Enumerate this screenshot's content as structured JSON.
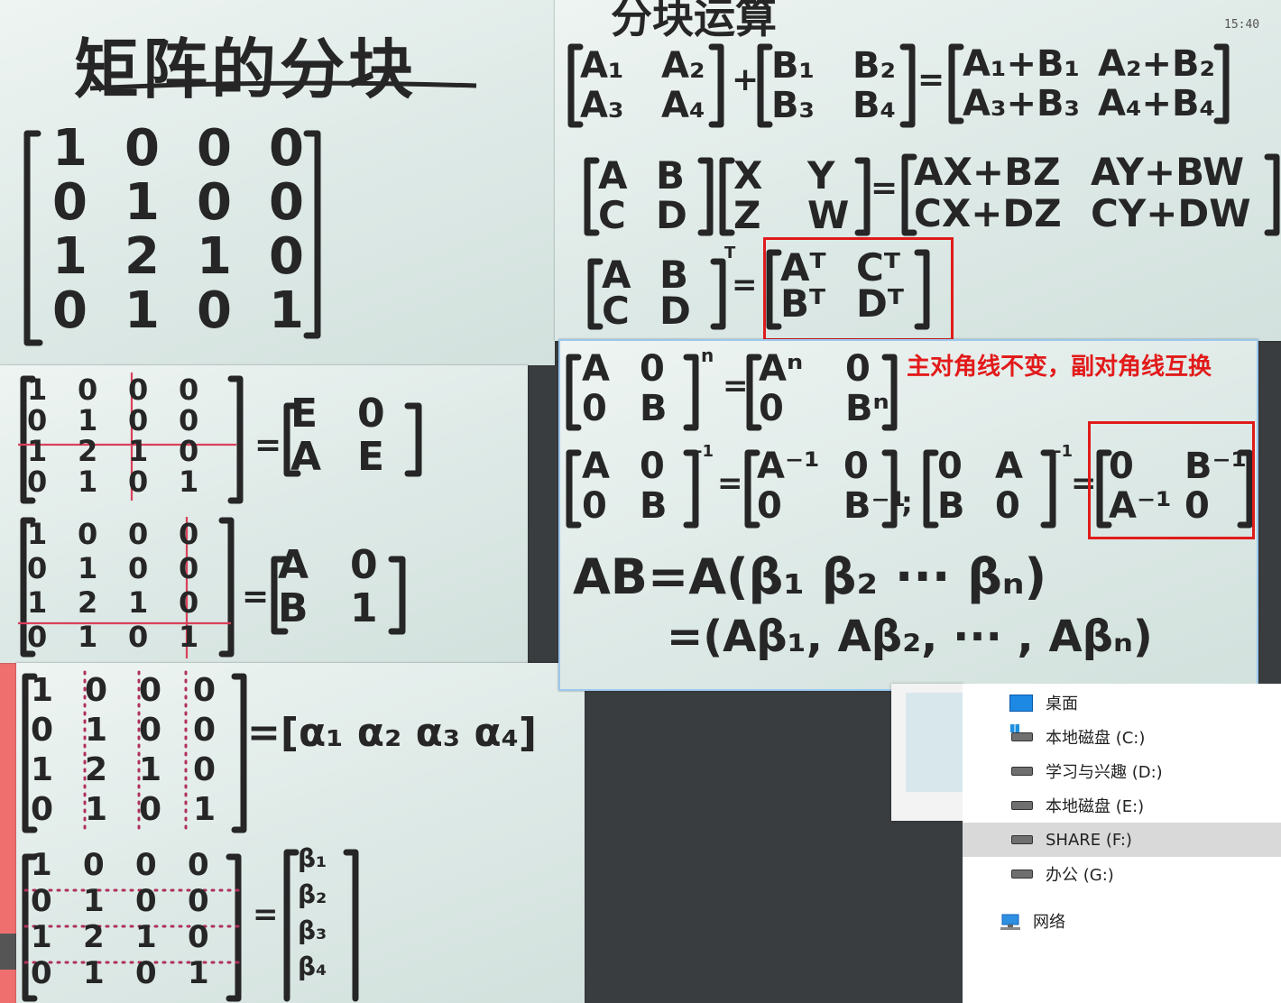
{
  "title": "矩阵的分块",
  "ops_title": "分块运算",
  "clock": "15:40",
  "annotation": "主对角线不变，副对角线互换",
  "matrix": [
    [
      "1",
      "0",
      "0",
      "0"
    ],
    [
      "0",
      "1",
      "0",
      "0"
    ],
    [
      "1",
      "2",
      "1",
      "0"
    ],
    [
      "0",
      "1",
      "0",
      "1"
    ]
  ],
  "results": {
    "block_EA": [
      [
        "E",
        "0"
      ],
      [
        "A",
        "E"
      ]
    ],
    "block_AB1": [
      [
        "A",
        "0"
      ],
      [
        "B",
        "1"
      ]
    ],
    "alpha_row": "=[α₁ α₂ α₃ α₄]",
    "beta_col": [
      "β₁",
      "β₂",
      "β₃",
      "β₄"
    ]
  },
  "formulas": {
    "add_lhs1": [
      [
        "A₁",
        "A₂"
      ],
      [
        "A₃",
        "A₄"
      ]
    ],
    "add_lhs2": [
      [
        "B₁",
        "B₂"
      ],
      [
        "B₃",
        "B₄"
      ]
    ],
    "add_rhs": [
      [
        "A₁+B₁",
        "A₂+B₂"
      ],
      [
        "A₃+B₃",
        "A₄+B₄"
      ]
    ],
    "mul_lhs1": [
      [
        "A",
        "B"
      ],
      [
        "C",
        "D"
      ]
    ],
    "mul_lhs2": [
      [
        "X",
        "Y"
      ],
      [
        "Z",
        "W"
      ]
    ],
    "mul_rhs": [
      [
        "AX+BZ",
        "AY+BW"
      ],
      [
        "CX+DZ",
        "CY+DW"
      ]
    ],
    "tr_lhs": [
      [
        "A",
        "B"
      ],
      [
        "C",
        "D"
      ]
    ],
    "tr_rhs": [
      [
        "Aᵀ",
        "Cᵀ"
      ],
      [
        "Bᵀ",
        "Dᵀ"
      ]
    ],
    "pow_lhs": [
      [
        "A",
        "0"
      ],
      [
        "0",
        "B"
      ]
    ],
    "pow_rhs": [
      [
        "Aⁿ",
        "0"
      ],
      [
        "0",
        "Bⁿ"
      ]
    ],
    "inv_lhs": [
      [
        "A",
        "0"
      ],
      [
        "0",
        "B"
      ]
    ],
    "inv_rhs": [
      [
        "A⁻¹",
        "0"
      ],
      [
        "0",
        "B⁻¹"
      ]
    ],
    "inv2_lhs": [
      [
        "0",
        "A"
      ],
      [
        "B",
        "0"
      ]
    ],
    "inv2_rhs": [
      [
        "0",
        "B⁻¹"
      ],
      [
        "A⁻¹",
        "0"
      ]
    ],
    "ab_line1": "AB=A(β₁ β₂ ··· βₙ)",
    "ab_line2": "=(Aβ₁, Aβ₂, ··· , Aβₙ)"
  },
  "explorer": {
    "items": [
      {
        "label": "桌面",
        "icon": "desktop-icon"
      },
      {
        "label": "本地磁盘 (C:)",
        "icon": "system-drive-icon"
      },
      {
        "label": "学习与兴趣 (D:)",
        "icon": "drive-icon"
      },
      {
        "label": "本地磁盘 (E:)",
        "icon": "drive-icon"
      },
      {
        "label": "SHARE (F:)",
        "icon": "drive-icon",
        "selected": true
      },
      {
        "label": "办公 (G:)",
        "icon": "drive-icon"
      }
    ],
    "network": "网络"
  }
}
